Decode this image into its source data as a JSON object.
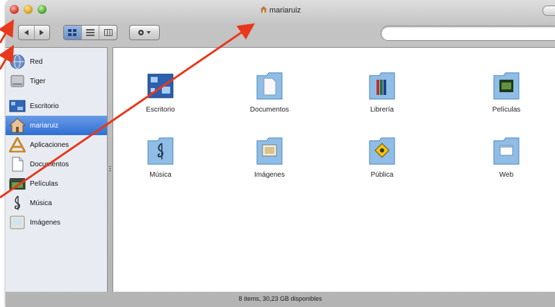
{
  "window": {
    "title": "mariaruiz"
  },
  "colors": {
    "annotation_arrow": "#e8381c",
    "selection": "#3d7bd8",
    "folder": "#8fbde6"
  },
  "sidebar": {
    "devices": [
      {
        "label": "Red",
        "icon": "network-globe-icon"
      },
      {
        "label": "Tiger",
        "icon": "hard-disk-icon"
      }
    ],
    "places": [
      {
        "label": "Escritorio",
        "icon": "desktop-icon"
      },
      {
        "label": "mariaruiz",
        "icon": "home-icon",
        "selected": true
      },
      {
        "label": "Aplicaciones",
        "icon": "applications-icon"
      },
      {
        "label": "Documentos",
        "icon": "documents-icon"
      },
      {
        "label": "Películas",
        "icon": "movies-icon"
      },
      {
        "label": "Música",
        "icon": "music-icon"
      },
      {
        "label": "Imágenes",
        "icon": "pictures-icon"
      }
    ]
  },
  "folders": [
    {
      "label": "Escritorio",
      "icon": "desktop-folder-icon"
    },
    {
      "label": "Documentos",
      "icon": "documents-folder-icon"
    },
    {
      "label": "Librería",
      "icon": "library-folder-icon"
    },
    {
      "label": "Películas",
      "icon": "movies-folder-icon"
    },
    {
      "label": "Música",
      "icon": "music-folder-icon"
    },
    {
      "label": "Imágenes",
      "icon": "pictures-folder-icon"
    },
    {
      "label": "Pública",
      "icon": "public-folder-icon"
    },
    {
      "label": "Web",
      "icon": "web-folder-icon"
    }
  ],
  "statusbar": {
    "text": "8 ítems, 30,23 GB disponibles"
  }
}
